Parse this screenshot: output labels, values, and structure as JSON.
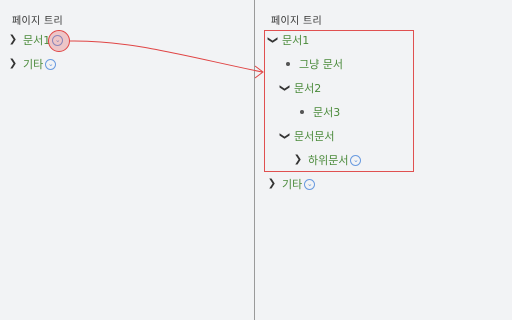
{
  "left_panel": {
    "title": "페이지 트리",
    "items": [
      {
        "label": "문서1",
        "expanded": false,
        "highlighted": true,
        "action_icon": "chevron-down-circle-icon"
      },
      {
        "label": "기타",
        "expanded": false,
        "action_icon": "chevron-down-circle-icon"
      }
    ]
  },
  "right_panel": {
    "title": "페이지 트리",
    "tree": [
      {
        "label": "문서1",
        "expanded": true,
        "level": 0
      },
      {
        "label": "그냥 문서",
        "level": 1,
        "leaf": true
      },
      {
        "label": "문서2",
        "expanded": true,
        "level": 1
      },
      {
        "label": "문서3",
        "level": 2,
        "leaf": true
      },
      {
        "label": "문서문서",
        "expanded": true,
        "level": 1
      },
      {
        "label": "하위문서",
        "expanded": false,
        "level": 2,
        "action_icon": "chevron-down-circle-icon"
      },
      {
        "label": "기타",
        "expanded": false,
        "level": 0,
        "action_icon": "chevron-down-circle-icon"
      }
    ]
  },
  "colors": {
    "background": "#f2f3f5",
    "link_text": "#4a8a3a",
    "annotation": "#e04444",
    "icon_blue": "#6a9be0"
  }
}
